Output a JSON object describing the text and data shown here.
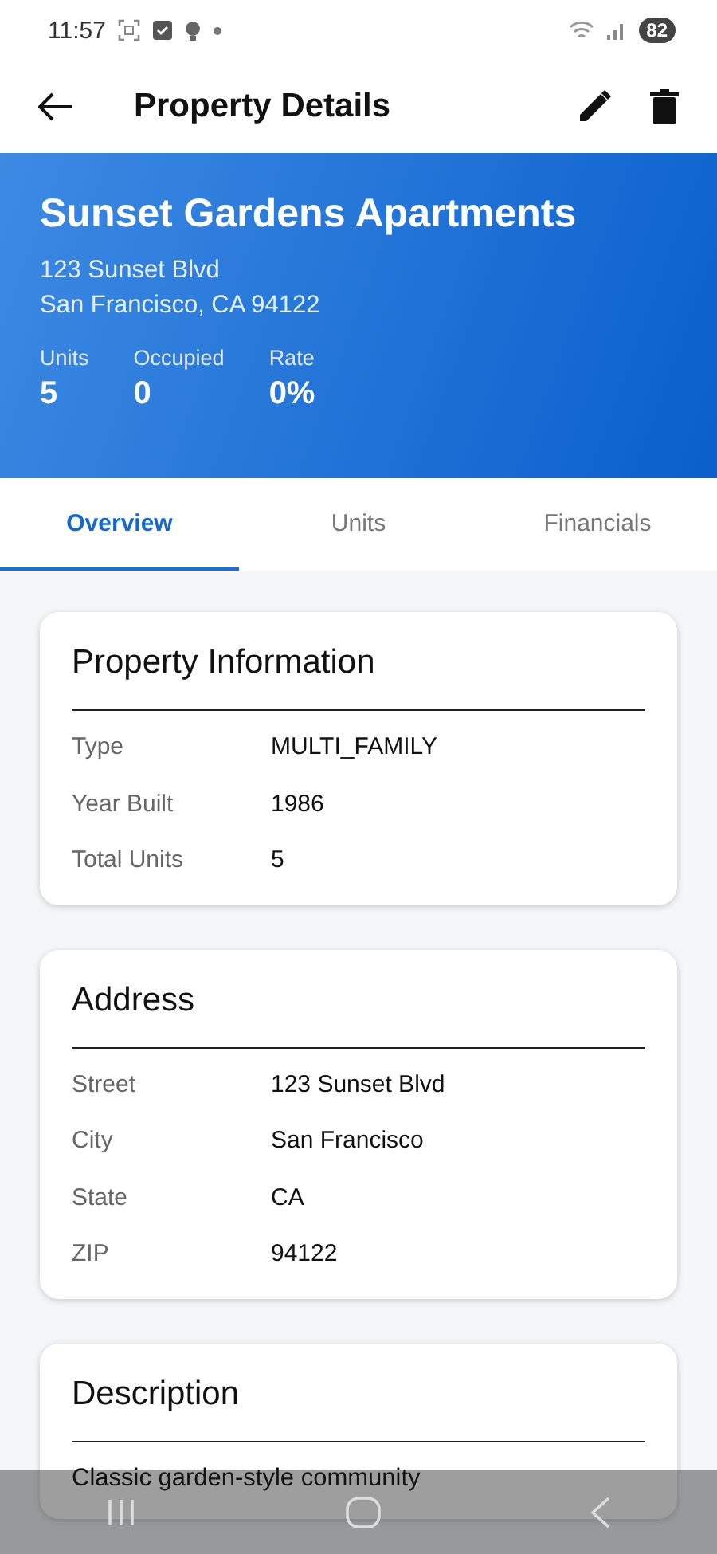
{
  "status_bar": {
    "time": "11:57",
    "battery": "82"
  },
  "app_bar": {
    "title": "Property Details"
  },
  "header": {
    "name": "Sunset Gardens Apartments",
    "address_lines": [
      "123 Sunset Blvd",
      "San Francisco, CA 94122"
    ],
    "stats": [
      {
        "label": "Units",
        "value": "5"
      },
      {
        "label": "Occupied",
        "value": "0"
      },
      {
        "label": "Rate",
        "value": "0%"
      }
    ]
  },
  "tabs": [
    {
      "label": "Overview",
      "selected": true
    },
    {
      "label": "Units",
      "selected": false
    },
    {
      "label": "Financials",
      "selected": false
    }
  ],
  "cards": [
    {
      "title": "Property Information",
      "rows": [
        {
          "label": "Type",
          "value": "MULTI_FAMILY"
        },
        {
          "label": "Year Built",
          "value": "1986"
        },
        {
          "label": "Total Units",
          "value": "5"
        }
      ]
    },
    {
      "title": "Address",
      "rows": [
        {
          "label": "Street",
          "value": "123 Sunset Blvd"
        },
        {
          "label": "City",
          "value": "San Francisco"
        },
        {
          "label": "State",
          "value": "CA"
        },
        {
          "label": "ZIP",
          "value": "94122"
        }
      ]
    },
    {
      "title": "Description",
      "text": "Classic garden-style community"
    }
  ]
}
